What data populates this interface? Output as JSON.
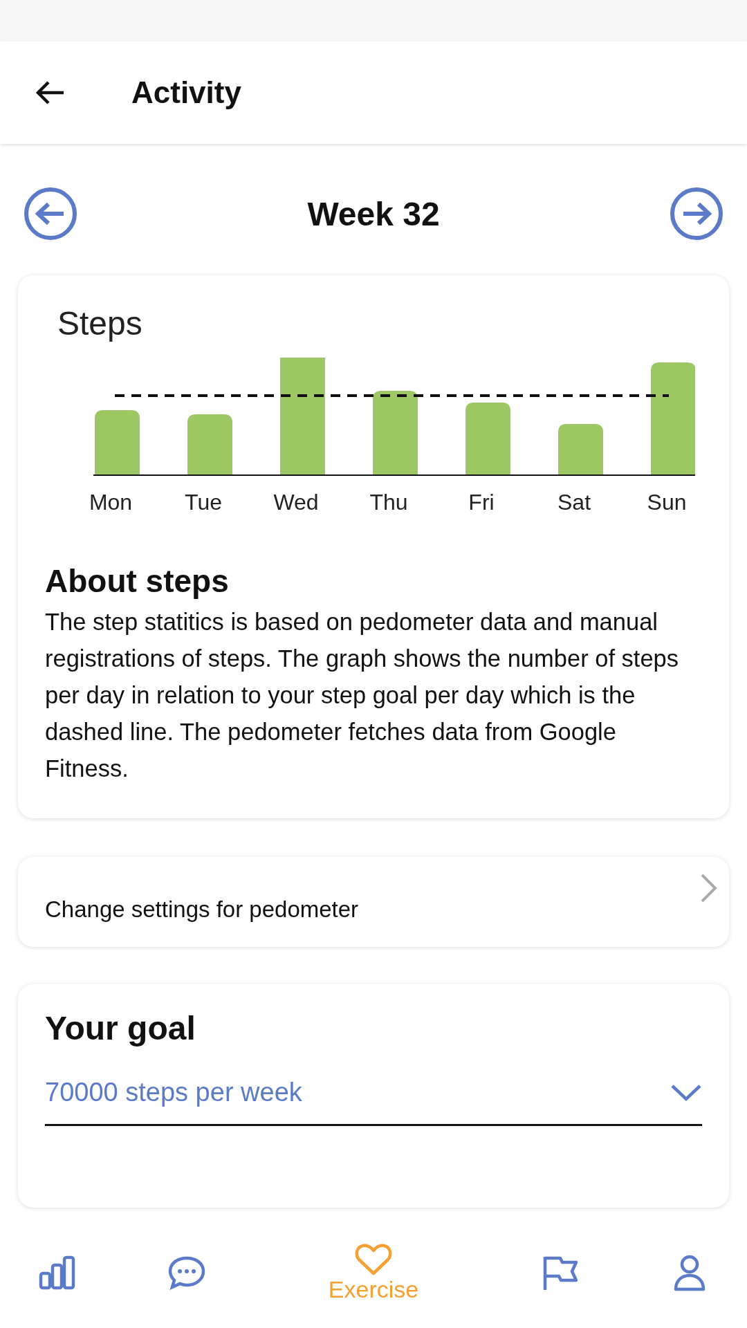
{
  "header": {
    "title": "Activity"
  },
  "week": {
    "label": "Week 32"
  },
  "steps_card": {
    "title": "Steps",
    "days": [
      "Mon",
      "Tue",
      "Wed",
      "Thu",
      "Fri",
      "Sat",
      "Sun"
    ],
    "about_title": "About steps",
    "about_text": "The step statitics is based on pedometer data and manual registrations of steps. The graph shows the number of steps per day in relation to your step goal per day which is the dashed line. The pedometer fetches data from Google Fitness."
  },
  "settings_link": {
    "label": "Change settings for pedometer"
  },
  "goal_card": {
    "title": "Your goal",
    "value": "70000 steps per week"
  },
  "bottom_nav": [
    {
      "kind": "stats",
      "selected": false
    },
    {
      "kind": "chat",
      "selected": false
    },
    {
      "kind": "heart",
      "selected": true,
      "label": "Exercise"
    },
    {
      "kind": "flag",
      "selected": false
    },
    {
      "kind": "person",
      "selected": false
    }
  ]
}
